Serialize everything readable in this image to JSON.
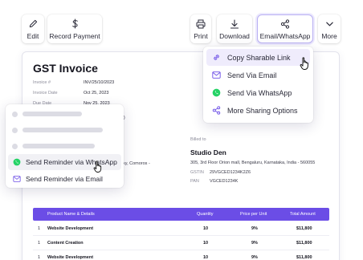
{
  "toolbar": {
    "edit": "Edit",
    "record_payment": "Record Payment",
    "print": "Print",
    "download": "Download",
    "email_whatsapp": "Email/WhatsApp",
    "more": "More"
  },
  "invoice": {
    "title": "GST Invoice",
    "meta": [
      {
        "label": "Invoice #",
        "value": "INV/25/10/2023"
      },
      {
        "label": "Invoice Date",
        "value": "Oct 25, 2023"
      },
      {
        "label": "Due Date",
        "value": "Nov 25, 2023"
      }
    ],
    "partial_text": {
      "p1": "(6)",
      "p2": "icky, Comoros -"
    },
    "billed_to": {
      "label": "Billed to",
      "name": "Studio Den",
      "address": "305, 3rd Floor Orion mall, Bengaluru, Karnataka, India - 560055",
      "gstin_label": "GSTIN",
      "gstin_value": "29VGCED1234K2Z6",
      "pan_label": "PAN",
      "pan_value": "VGCED1234K"
    },
    "table": {
      "headers": [
        "Product Name & Details",
        "Quantity",
        "Price per Unit",
        "Total Amount"
      ],
      "rows": [
        {
          "num": "1",
          "name": "Website Development",
          "qty": "10",
          "price": "9%",
          "total": "$11,800"
        },
        {
          "num": "1",
          "name": "Content Creation",
          "qty": "10",
          "price": "9%",
          "total": "$11,800"
        },
        {
          "num": "1",
          "name": "Website Development",
          "qty": "10",
          "price": "9%",
          "total": "$11,800"
        }
      ]
    }
  },
  "share_menu": {
    "items": [
      {
        "label": "Copy Sharable Link",
        "icon": "link-icon"
      },
      {
        "label": "Send Via Email",
        "icon": "mail-icon"
      },
      {
        "label": "Send Via WhatsApp",
        "icon": "whatsapp-icon"
      },
      {
        "label": "More Sharing Options",
        "icon": "share-icon"
      }
    ]
  },
  "reminder_menu": {
    "items": [
      {
        "label": "Send Reminder via WhatsApp",
        "icon": "whatsapp-icon"
      },
      {
        "label": "Send Reminder via Email",
        "icon": "mail-icon"
      }
    ]
  },
  "colors": {
    "accent": "#6b4de6",
    "whatsapp": "#25d366",
    "active_border": "#b9b0f3"
  }
}
